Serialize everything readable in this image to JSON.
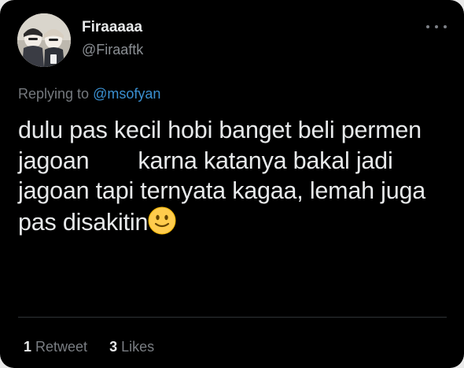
{
  "tweet": {
    "author": {
      "display_name": "Firaaaaa",
      "handle": "@Firaaftk",
      "avatar_icon": "profile-photo"
    },
    "more_icon": "more-horizontal-icon",
    "replying_prefix": "Replying to",
    "replying_to": "@msofyan",
    "text_lines": [
      "dulu pas kecil hobi banget beli permen",
      "jagoan",
      "karna katanya bakal jadi",
      "jagoan tapi ternyata kagaa, lemah juga",
      "pas disakitin"
    ],
    "emoji": "slightly-smiling-face",
    "stats": {
      "retweets_count": "1",
      "retweets_label": "Retweet",
      "likes_count": "3",
      "likes_label": "Likes"
    }
  },
  "colors": {
    "background": "#000000",
    "text": "#e7e9ea",
    "muted": "#8b8f94",
    "link": "#3a8fd0"
  }
}
